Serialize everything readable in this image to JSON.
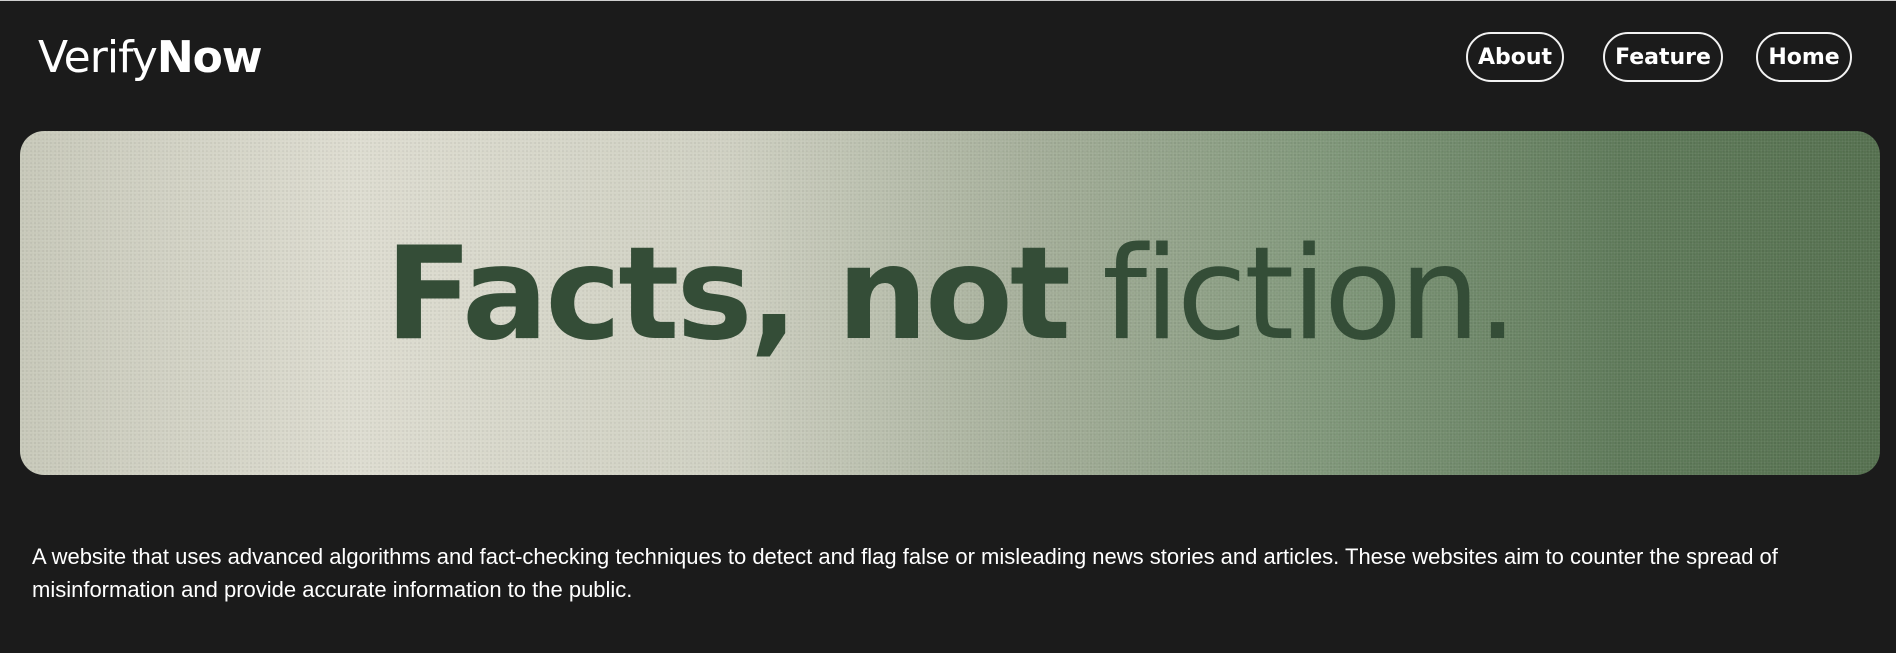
{
  "header": {
    "logo_light": "Verify",
    "logo_bold": "Now",
    "nav": [
      {
        "label": "About"
      },
      {
        "label": "Feature"
      },
      {
        "label": "Home"
      }
    ]
  },
  "hero": {
    "title_strong": "Facts, not",
    "title_light": "fiction."
  },
  "description": "A website that uses advanced algorithms and fact-checking techniques to detect and flag false or misleading news stories and articles. These websites aim to counter the spread of misinformation and provide accurate information to the public.",
  "colors": {
    "background": "#1b1b1b",
    "hero_text": "#344d37",
    "hero_gradient_start": "#dddcd0",
    "hero_gradient_end": "#55704f",
    "nav_border": "#f2f2f2"
  }
}
